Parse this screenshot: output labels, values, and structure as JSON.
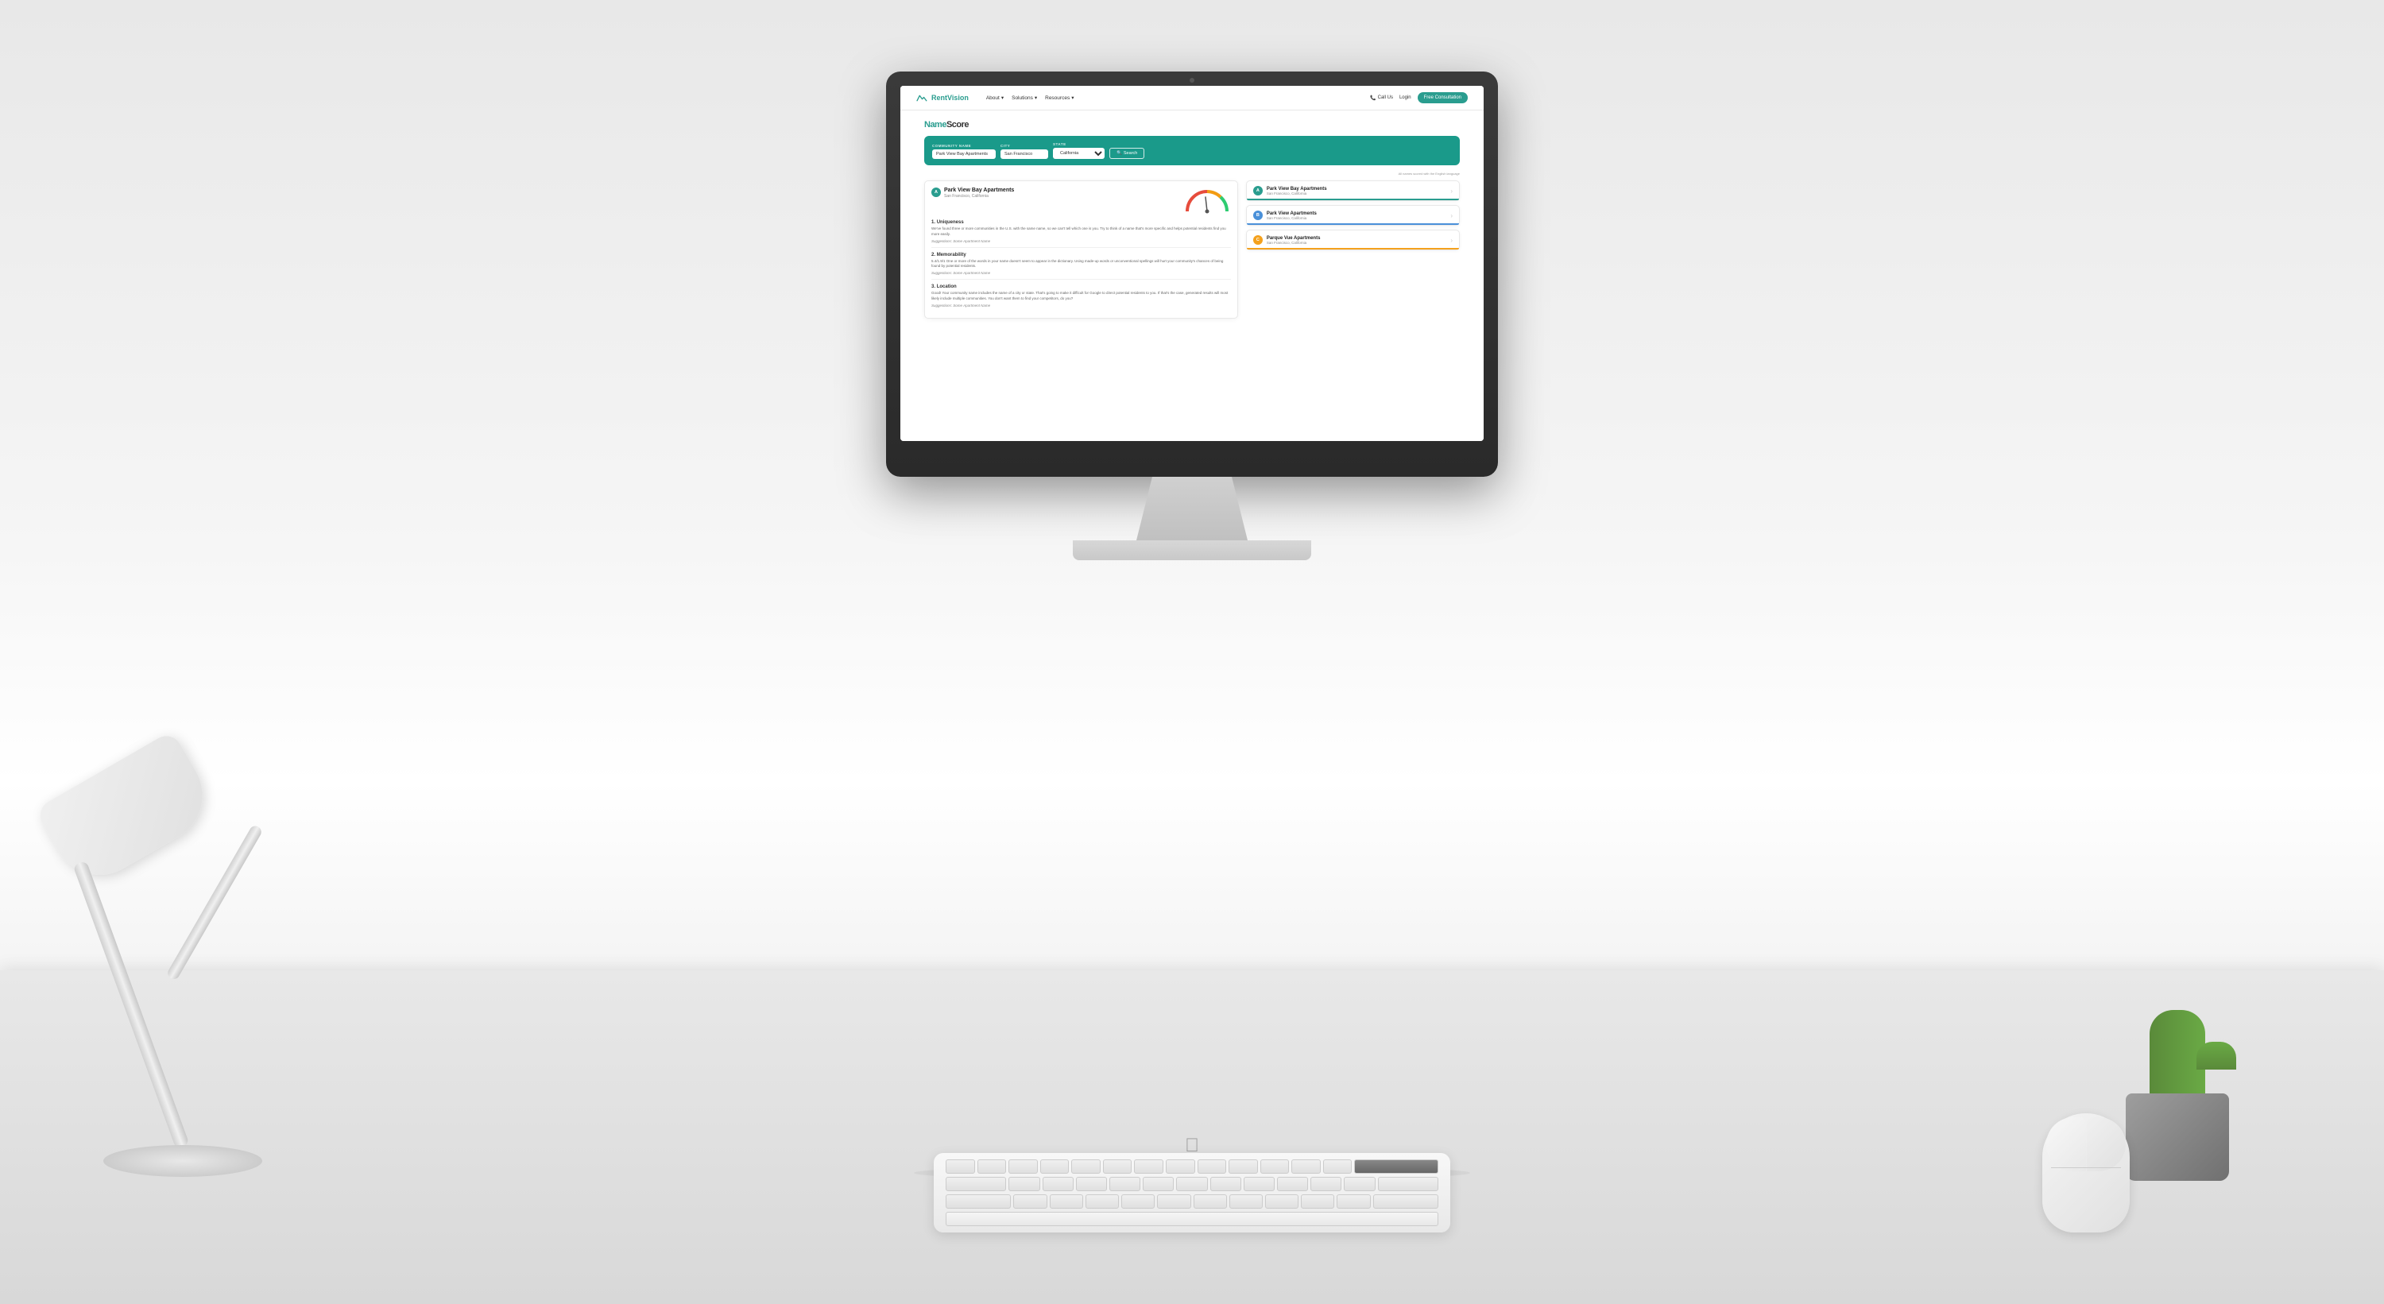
{
  "background": {
    "color": "#e8e8e8"
  },
  "nav": {
    "logo": "RentVision",
    "links": [
      {
        "label": "About",
        "has_dropdown": true
      },
      {
        "label": "Solutions",
        "has_dropdown": true
      },
      {
        "label": "Resources",
        "has_dropdown": true
      }
    ],
    "call_label": "Call Us",
    "login_label": "Login",
    "consultation_label": "Free Consultation"
  },
  "namescore": {
    "brand": "NameScore",
    "fields": {
      "community_name_label": "COMMUNITY NAME",
      "community_name_value": "Park View Bay Apartments",
      "city_label": "CITY",
      "city_value": "San Francisco",
      "state_label": "STATE",
      "state_value": "California",
      "search_button": "Search"
    },
    "disclaimer": "All names scored with the English language"
  },
  "result_detail": {
    "score": "A",
    "name": "Park View Bay Apartments",
    "location": "San Francisco, California",
    "criteria": [
      {
        "number": "1.",
        "title": "Uniqueness",
        "description": "We've found three or more communities in the U.S. with the same name, so we can't tell which one is you. Try to think of a name that's more specific and helps potential residents find you more easily.",
        "suggestion_label": "Suggestions: Some Apartment Name"
      },
      {
        "number": "2.",
        "title": "Memorability",
        "description": "5.4/1.9/1 One or more of the words in your name doesn't seem to appear in the dictionary. Using made-up words or unconventional spellings will hurt your community's chances of being found by potential residents.",
        "suggestion_label": "Suggestions: Some Apartment Name"
      },
      {
        "number": "3.",
        "title": "Location",
        "description": "Good! Your community name includes the name of a city or state. That's going to make it difficult for Google to direct potential residents to you. If that's the case, generated results will most likely include multiple communities. You don't want them to find your competitors, do you?",
        "suggestion_label": "Suggestions: Some Apartment Name"
      }
    ]
  },
  "result_list": [
    {
      "score": "A",
      "score_color": "green",
      "name": "Park View Bay Apartments",
      "location": "San Francisco, California",
      "bar_color": "green"
    },
    {
      "score": "B",
      "score_color": "blue",
      "name": "Park View Apartments",
      "location": "San Francisco, California",
      "bar_color": "blue"
    },
    {
      "score": "C",
      "score_color": "yellow",
      "name": "Parque Vue Apartments",
      "location": "San Francisco, California",
      "bar_color": "yellow"
    }
  ]
}
